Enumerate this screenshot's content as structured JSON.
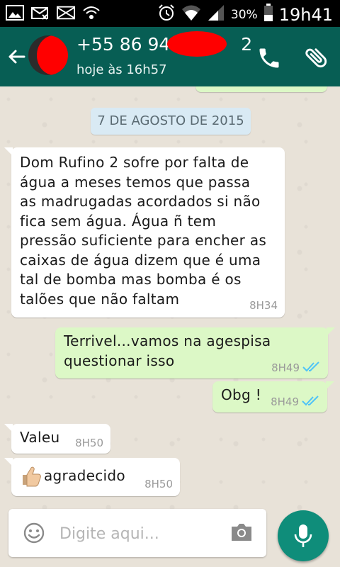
{
  "status_bar": {
    "battery_percent": "30%",
    "time": "19h41",
    "left_icons": [
      "image-icon",
      "missed-sms-icon",
      "mail-icon",
      "wifi-icon"
    ],
    "right_icons": [
      "alarm-icon",
      "wifi-icon",
      "signal-icon",
      "battery-icon"
    ]
  },
  "header": {
    "title": "+55 86 949",
    "title_suffix": "2",
    "subtitle": "hoje às 16h57",
    "color": "#075e54"
  },
  "chat": {
    "date_chip": "7 DE AGOSTO DE 2015",
    "messages": [
      {
        "direction": "in",
        "text": "Dom Rufino 2 sofre por falta de\nágua a meses temos que passa\nas madrugadas acordados si não\nfica sem água. Água ñ tem\npressão suficiente para encher as\ncaixas de água dizem que é uma\ntal de bomba mas bomba é os\ntalões que não faltam",
        "time": "8H34"
      },
      {
        "direction": "out",
        "text": "Terrivel...vamos na agespisa\nquestionar isso",
        "time": "8H49",
        "status": "read"
      },
      {
        "direction": "out",
        "text": "Obg !",
        "time": "8H49",
        "status": "read"
      },
      {
        "direction": "in",
        "text": "Valeu",
        "time": "8H50"
      },
      {
        "direction": "in",
        "emoji": "thumbs-up-icon",
        "text": "agradecido",
        "time": "8H50"
      }
    ]
  },
  "composer": {
    "placeholder": "Digite aqui...",
    "value": ""
  },
  "colors": {
    "outgoing_bubble": "#dcf8c6",
    "incoming_bubble": "#ffffff",
    "read_tick": "#4fc3f7",
    "fab": "#0f8d7a"
  }
}
